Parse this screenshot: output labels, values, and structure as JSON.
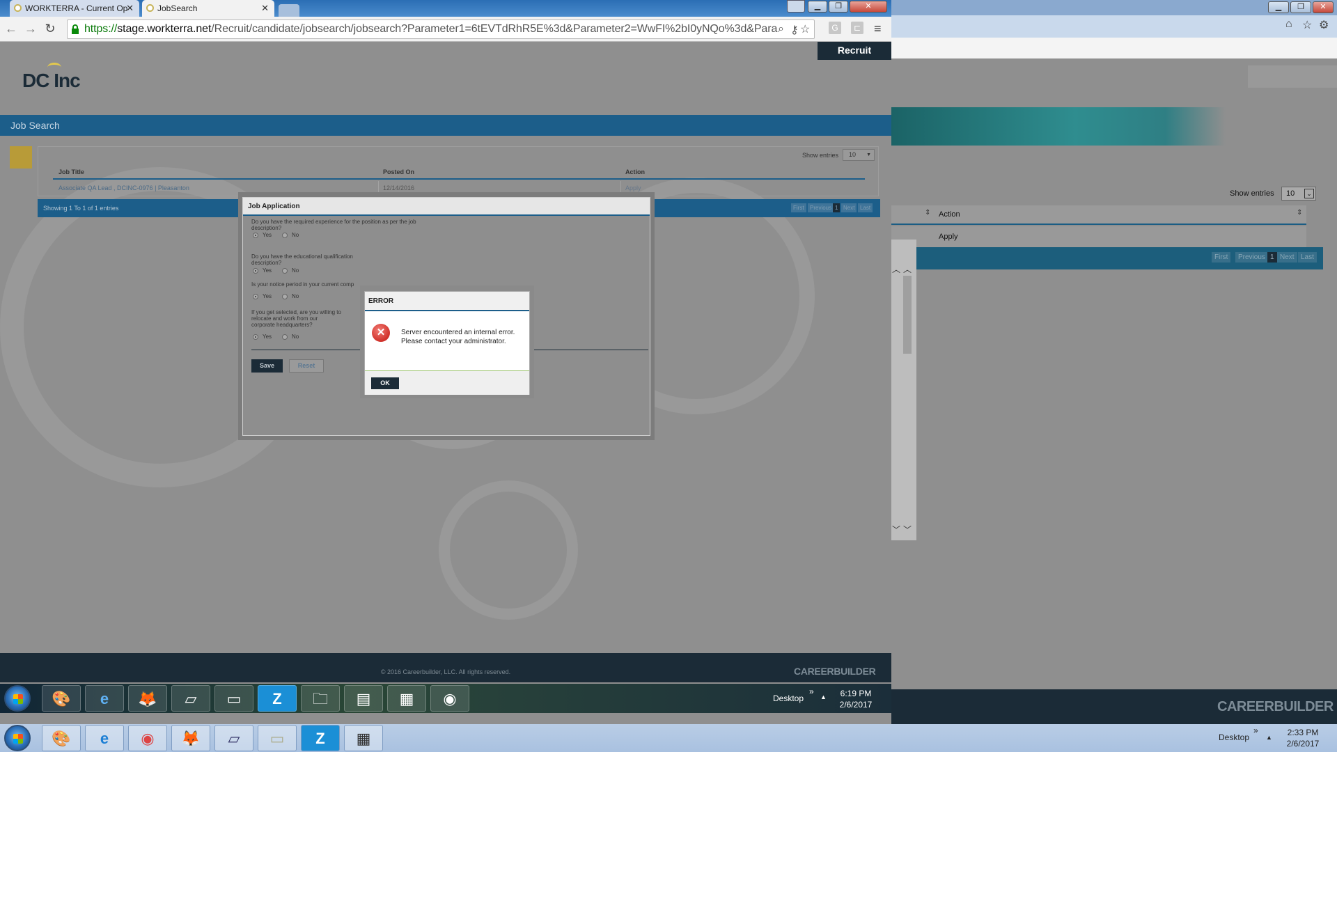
{
  "browser": {
    "tabs": [
      {
        "label": "WORKTERRA - Current Op",
        "close": "✕"
      },
      {
        "label": "JobSearch",
        "close": "✕"
      }
    ],
    "url_scheme": "https://",
    "url_host": "stage.workterra.net",
    "url_path": "/Recruit/candidate/jobsearch/jobsearch?Parameter1=6tEVTdRhR5E%3d&Parameter2=WwFI%2bI0yNQo%3d&Para",
    "window_controls": [
      "▁",
      "❐",
      "✕"
    ]
  },
  "page": {
    "recruit_tab": "Recruit",
    "logo_text": "DC Inc",
    "section_title": "Job Search",
    "show_entries_label": "Show entries",
    "show_entries_value": "10",
    "table": {
      "headers": [
        "Job Title",
        "Posted On",
        "Action"
      ],
      "rows": [
        {
          "title": "Associate QA Lead , DCINC-0976 | Pleasanton",
          "posted": "12/14/2016",
          "action": "Apply"
        }
      ]
    },
    "showing_text": "Showing 1 To 1 of 1 entries",
    "pager": [
      "First",
      "Previous",
      "1",
      "Next",
      "Last"
    ],
    "footer_copyright": "© 2016 Careerbuilder, LLC. All rights reserved.",
    "footer_logo": "CAREERBUILDER"
  },
  "job_application": {
    "title": "Job Application",
    "questions": [
      {
        "text": "Do you have the required experience for the position as per the job description?",
        "yes": "Yes",
        "no": "No"
      },
      {
        "text": "Do you have the educational qualification description?",
        "yes": "Yes",
        "no": "No"
      },
      {
        "text": "Is your notice period in your current comp",
        "yes": "Yes",
        "no": "No"
      },
      {
        "text": "If you get selected, are you willing to relocate and work from our corporate headquarters?",
        "yes": "Yes",
        "no": "No"
      }
    ],
    "save_label": "Save",
    "reset_label": "Reset"
  },
  "error_dialog": {
    "title": "ERROR",
    "message": "Server encountered an internal error. Please contact your administrator.",
    "ok_label": "OK",
    "icon": "error-x-icon"
  },
  "background_window": {
    "show_entries_label": "Show entries",
    "show_entries_value": "10",
    "action_header": "Action",
    "action_cell": "Apply",
    "pager": [
      "First",
      "Previous",
      "1",
      "Next",
      "Last"
    ],
    "footer_logo": "CAREERBUILDER",
    "window_controls": [
      "▁",
      "❐",
      "✕"
    ],
    "toolbar_icons": [
      "home-icon",
      "star-icon",
      "gear-icon"
    ]
  },
  "taskbar_top": {
    "desktop_label": "Desktop",
    "time": "6:19 PM",
    "date": "2/6/2017"
  },
  "taskbar_bottom": {
    "desktop_label": "Desktop",
    "time": "2:33 PM",
    "date": "2/6/2017"
  }
}
